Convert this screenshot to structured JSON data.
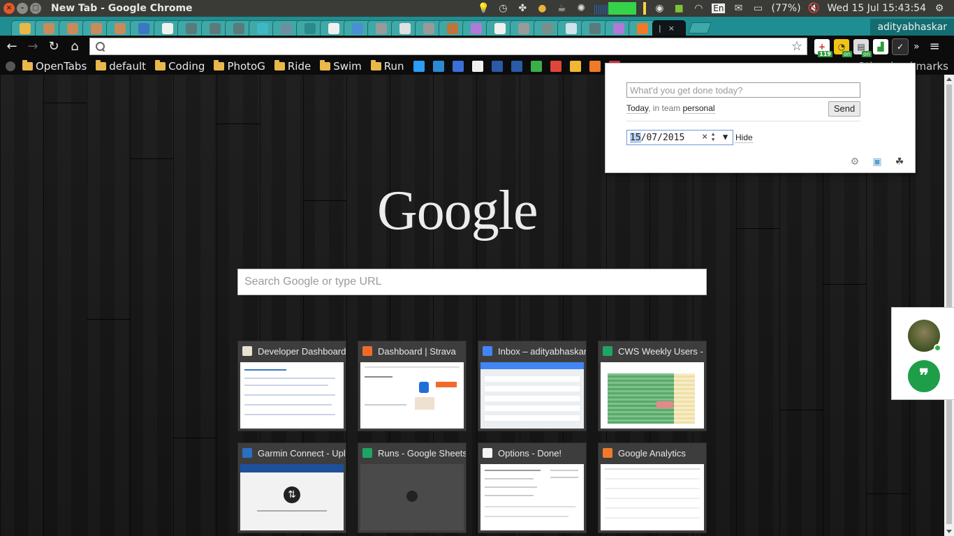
{
  "system": {
    "window_title": "New Tab - Google Chrome",
    "battery": "(77%)",
    "keyboard": "En",
    "clock": "Wed 15 Jul 15:43:54"
  },
  "browser": {
    "profile_name": "adityabhaskar",
    "omnibox_value": "",
    "ext_badges": {
      "ext1": "119",
      "ext2": "on",
      "ext3": "on"
    }
  },
  "bookmarks": {
    "folders": [
      "OpenTabs",
      "default",
      "Coding",
      "PhotoG",
      "Ride",
      "Swim",
      "Run"
    ],
    "other": "Other bookmarks"
  },
  "ntp": {
    "logo": "Google",
    "search_placeholder": "Search Google or type URL",
    "tiles": [
      {
        "title": "Developer Dashboard"
      },
      {
        "title": "Dashboard | Strava"
      },
      {
        "title": "Inbox – adityabhaskar"
      },
      {
        "title": "CWS Weekly Users -"
      },
      {
        "title": "Garmin Connect - Upl"
      },
      {
        "title": "Runs - Google Sheets"
      },
      {
        "title": "Options - Done!"
      },
      {
        "title": "Google Analytics"
      }
    ]
  },
  "popup": {
    "placeholder": "What'd you get done today?",
    "today": "Today",
    "in_team": ", in team ",
    "team": "personal",
    "send": "Send",
    "date_day": "15",
    "date_rest": "/07/2015",
    "hide": "Hide"
  },
  "colors": {
    "tabstrip": "#1f8e92",
    "chat_green": "#1f9e4a"
  }
}
